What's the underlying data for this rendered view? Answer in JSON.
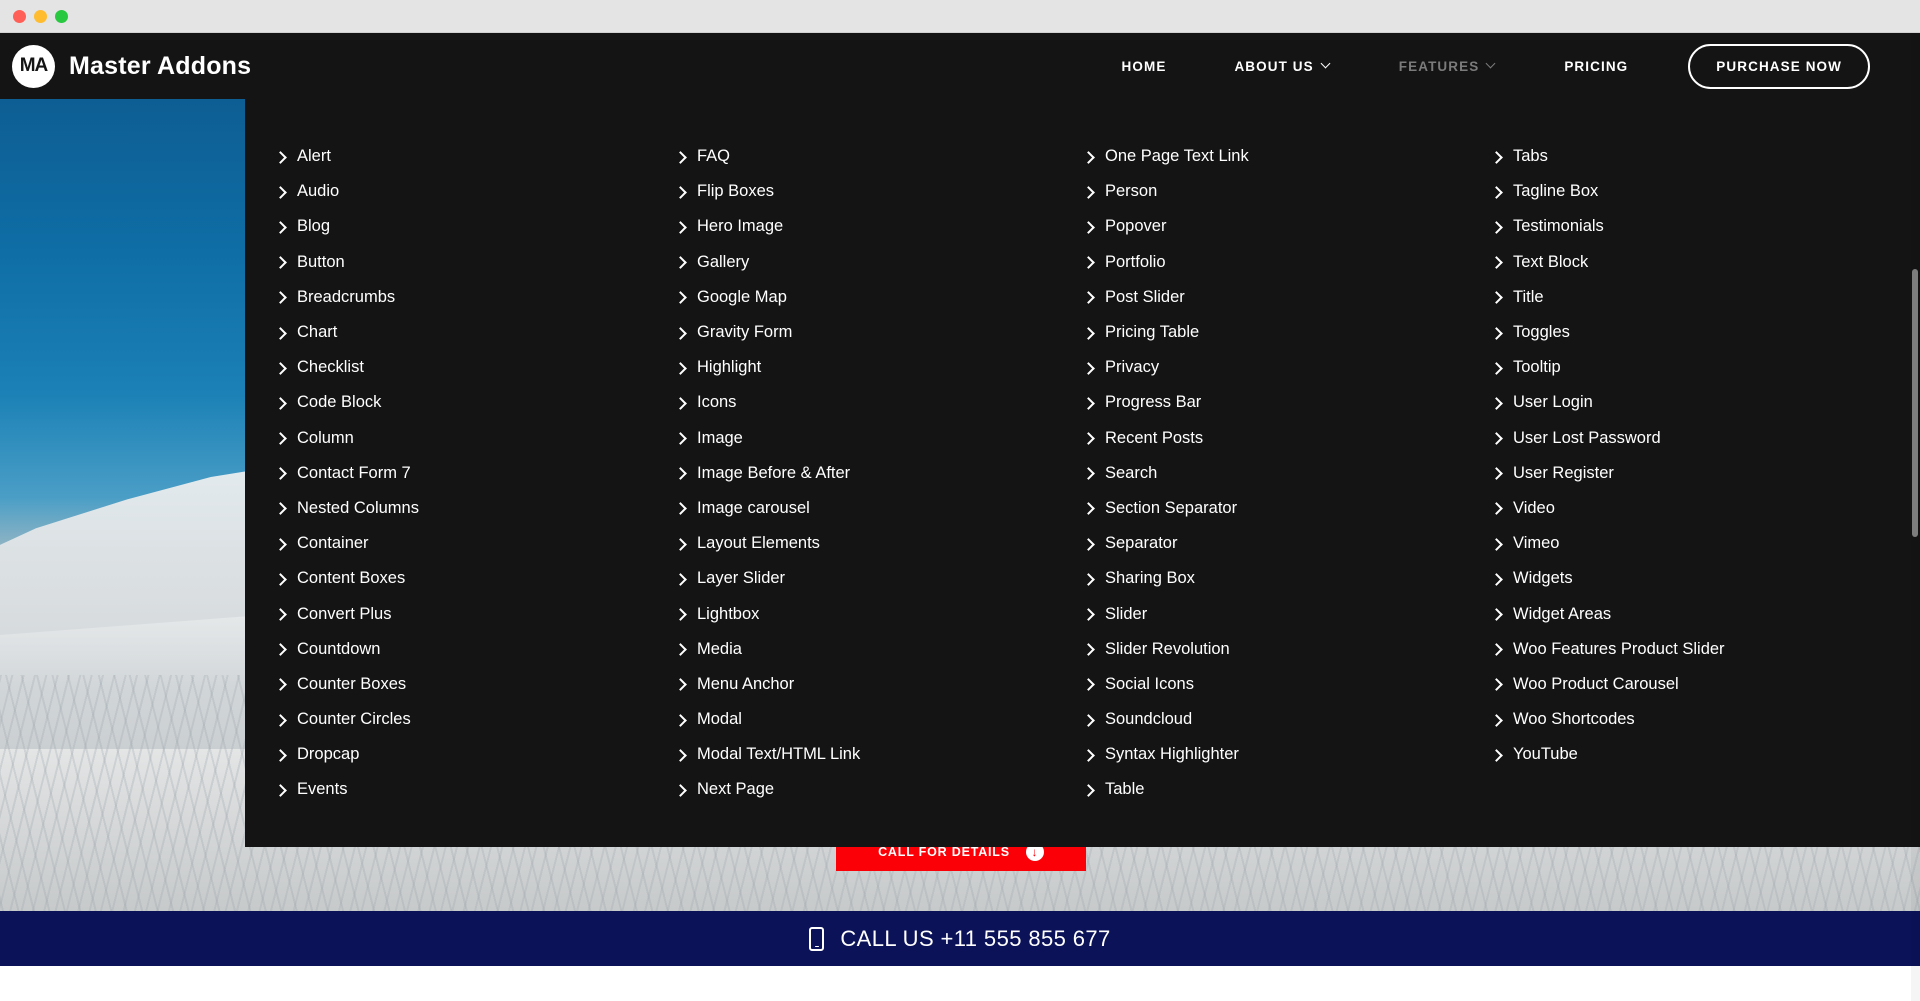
{
  "window": {
    "traffic_lights": [
      {
        "name": "close",
        "color": "#ff5f57"
      },
      {
        "name": "minimize",
        "color": "#febc2e"
      },
      {
        "name": "maximize",
        "color": "#28c840"
      }
    ]
  },
  "header": {
    "brand_mark": "MA",
    "brand_name": "Master Addons",
    "nav": [
      {
        "label": "HOME",
        "has_caret": false,
        "state": "normal"
      },
      {
        "label": "ABOUT US",
        "has_caret": true,
        "state": "normal"
      },
      {
        "label": "FEATURES",
        "has_caret": true,
        "state": "dim"
      },
      {
        "label": "PRICING",
        "has_caret": false,
        "state": "normal"
      }
    ],
    "purchase_label": "PURCHASE NOW"
  },
  "mega_menu": {
    "open_for": "FEATURES",
    "columns": [
      {
        "items": [
          "Alert",
          "Audio",
          "Blog",
          "Button",
          "Breadcrumbs",
          "Chart",
          "Checklist",
          "Code Block",
          "Column",
          "Contact Form 7",
          "Nested Columns",
          "Container",
          "Content Boxes",
          "Convert Plus",
          "Countdown",
          "Counter Boxes",
          "Counter Circles",
          "Dropcap",
          "Events"
        ]
      },
      {
        "items": [
          "FAQ",
          "Flip Boxes",
          "Hero Image",
          "Gallery",
          "Google Map",
          "Gravity Form",
          "Highlight",
          "Icons",
          "Image",
          "Image Before & After",
          "Image carousel",
          "Layout Elements",
          "Layer Slider",
          "Lightbox",
          "Media",
          "Menu Anchor",
          "Modal",
          "Modal Text/HTML Link",
          "Next Page"
        ]
      },
      {
        "items": [
          "One Page Text Link",
          "Person",
          "Popover",
          "Portfolio",
          "Post Slider",
          "Pricing Table",
          "Privacy",
          "Progress Bar",
          "Recent Posts",
          "Search",
          "Section Separator",
          "Separator",
          "Sharing Box",
          "Slider",
          "Slider Revolution",
          "Social Icons",
          "Soundcloud",
          "Syntax Highlighter",
          "Table"
        ]
      },
      {
        "items": [
          "Tabs",
          "Tagline Box",
          "Testimonials",
          "Text Block",
          "Title",
          "Toggles",
          "Tooltip",
          "User Login",
          "User Lost Password",
          "User Register",
          "Video",
          "Vimeo",
          "Widgets",
          "Widget Areas",
          "Woo Features Product Slider",
          "Woo Product Carousel",
          "Woo Shortcodes",
          "YouTube"
        ]
      }
    ]
  },
  "hero": {
    "cta_label": "CALL FOR DETAILS",
    "cta_icon": "arrow-down-circle-icon",
    "cta_color": "#fb0007"
  },
  "call_bar": {
    "icon": "mobile-phone-icon",
    "text": "CALL US +11 555 855 677",
    "background": "#0b1258"
  },
  "colors": {
    "header_bg": "#141414",
    "menu_bg": "#141414",
    "accent_red": "#fb0007",
    "call_bar_navy": "#0b1258",
    "text_white": "#ffffff",
    "nav_dim": "#7b7b7b"
  }
}
